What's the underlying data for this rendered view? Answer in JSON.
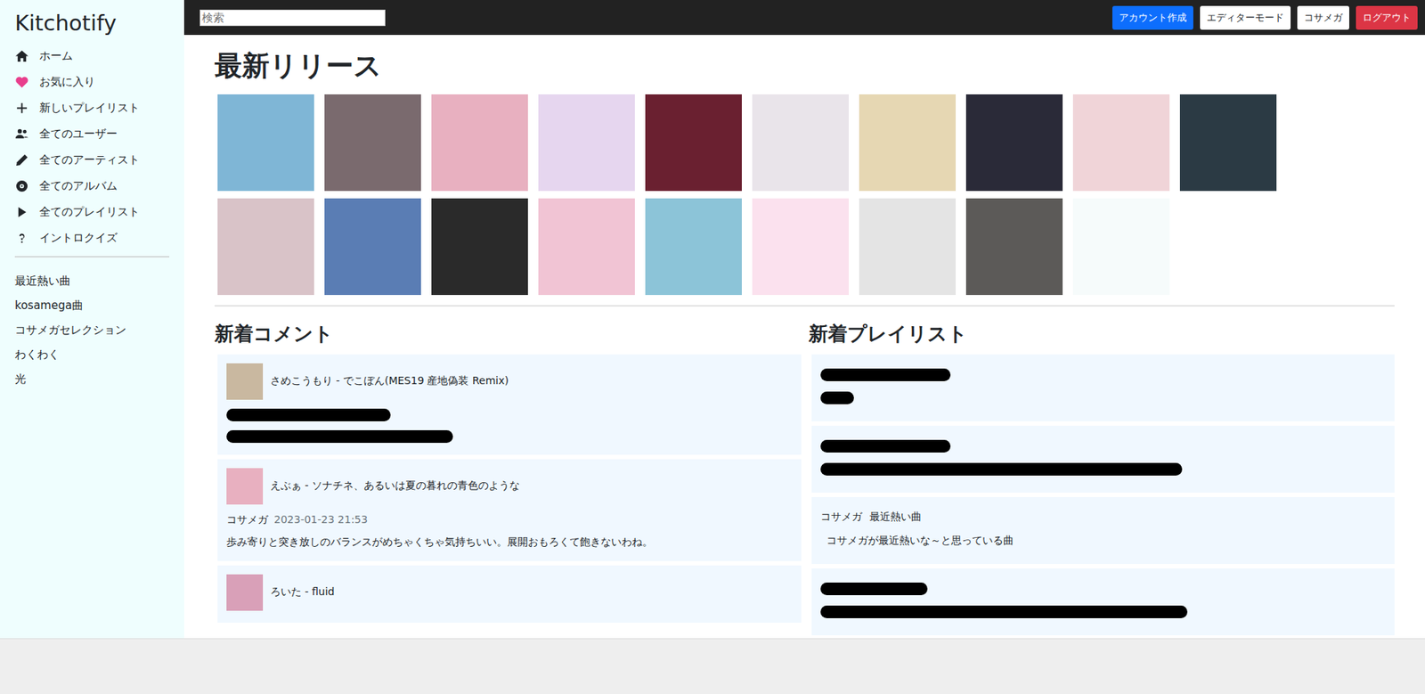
{
  "app": {
    "title": "Kitchotify"
  },
  "sidebar": {
    "nav": [
      {
        "label": "ホーム",
        "kind": "home"
      },
      {
        "label": "お気に入り",
        "kind": "heart"
      },
      {
        "label": "新しいプレイリスト",
        "kind": "plus"
      },
      {
        "label": "全てのユーザー",
        "kind": "users"
      },
      {
        "label": "全てのアーティスト",
        "kind": "pen"
      },
      {
        "label": "全てのアルバム",
        "kind": "disc"
      },
      {
        "label": "全てのプレイリスト",
        "kind": "play"
      },
      {
        "label": "イントロクイズ",
        "kind": "question"
      }
    ],
    "playlists": [
      "最近熱い曲",
      "kosamega曲",
      "コサメガセレクション",
      "わくわく",
      "光"
    ]
  },
  "topbar": {
    "search": {
      "placeholder": "検索"
    },
    "buttons": [
      {
        "label": "アカウント作成",
        "kind": "primary"
      },
      {
        "label": "エディターモード",
        "kind": "light"
      },
      {
        "label": "コサメガ",
        "kind": "light"
      },
      {
        "label": "ログアウト",
        "kind": "danger"
      }
    ]
  },
  "releases": {
    "title": "最新リリース",
    "albums": [
      {
        "color": "#7fb6d6"
      },
      {
        "color": "#7a6a6e"
      },
      {
        "color": "#e8b0c0"
      },
      {
        "color": "#e6d6ef"
      },
      {
        "color": "#6a2030"
      },
      {
        "color": "#e9e4ea"
      },
      {
        "color": "#e6d7b3"
      },
      {
        "color": "#2a2a38"
      },
      {
        "color": "#f0d4d8"
      },
      {
        "color": "#2b3a44"
      },
      {
        "color": "#d9c3c8"
      },
      {
        "color": "#5a7db4"
      },
      {
        "color": "#2a2a2a"
      },
      {
        "color": "#f1c4d4"
      },
      {
        "color": "#8cc4d8"
      },
      {
        "color": "#fbe1ee"
      },
      {
        "color": "#e4e4e4"
      },
      {
        "color": "#5c5a58"
      },
      {
        "color": "#f6fbfb"
      }
    ]
  },
  "comments": {
    "title": "新着コメント",
    "items": [
      {
        "track": "さめこうもり - でこぼん(MES19 産地偽装 Remix)",
        "color": "#c9b8a0",
        "lines": [
          {
            "kind": "redacted",
            "level": 0.29
          },
          {
            "kind": "redacted",
            "level": 0.4
          }
        ]
      },
      {
        "track": "えぶぁ - ソナチネ、あるいは夏の暮れの青色のような",
        "color": "#e8b0c0",
        "lines": [
          {
            "kind": "meta",
            "user": "コサメガ",
            "time": "2023-01-23 21:53"
          },
          {
            "kind": "text",
            "text": "歩み寄りと突き放しのバランスがめちゃくちゃ気持ちいい。展開おもろくて飽きないわね。"
          }
        ]
      },
      {
        "track": "ろいた - fluid",
        "color": "#d9a0b8",
        "lines": []
      }
    ]
  },
  "newPlaylists": {
    "title": "新着プレイリスト",
    "items": [
      {
        "lines": [
          {
            "kind": "redacted",
            "level": 0.23
          },
          {
            "kind": "redacted",
            "level": 0.063
          }
        ]
      },
      {
        "lines": [
          {
            "kind": "redacted",
            "level": 0.23
          },
          {
            "kind": "redacted",
            "level": 0.64
          }
        ]
      },
      {
        "lines": [
          {
            "kind": "title",
            "user": "コサメガ",
            "name": "最近熱い曲"
          },
          {
            "kind": "text",
            "text": "コサメガが最近熱いな～と思っている曲"
          }
        ]
      },
      {
        "lines": [
          {
            "kind": "redacted",
            "level": 0.19
          },
          {
            "kind": "redacted",
            "level": 0.65
          }
        ]
      }
    ]
  }
}
